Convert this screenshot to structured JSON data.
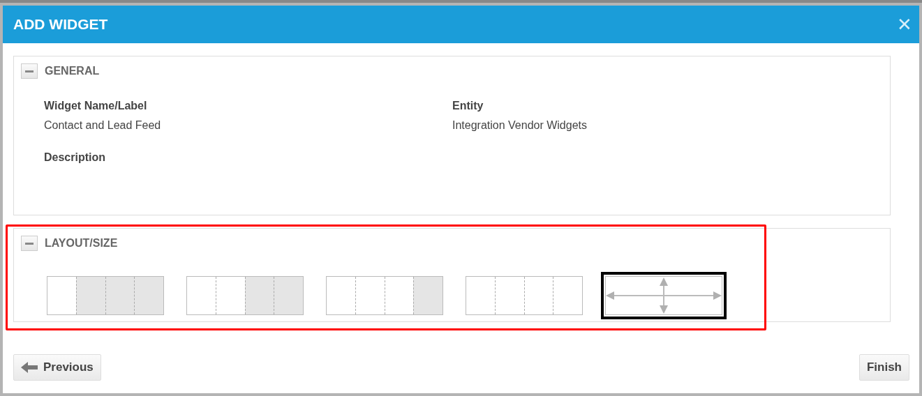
{
  "window": {
    "title": "ADD WIDGET",
    "close": "✕"
  },
  "general": {
    "title": "GENERAL",
    "expanded": true,
    "fields": [
      {
        "label": "Widget Name/Label",
        "value": "Contact and Lead Feed"
      },
      {
        "label": "Entity",
        "value": "Integration Vendor Widgets"
      },
      {
        "label": "Description"
      }
    ]
  },
  "layout": {
    "title": "LAYOUT/SIZE",
    "expanded": true,
    "highlighted": true,
    "options": [
      {
        "kind": "columns",
        "selected": false,
        "cells": [
          {
            "shaded": false
          },
          {
            "shaded": true
          },
          {
            "shaded": true
          },
          {
            "shaded": true
          }
        ]
      },
      {
        "kind": "columns",
        "selected": false,
        "cells": [
          {
            "shaded": false
          },
          {
            "shaded": false
          },
          {
            "shaded": true
          },
          {
            "shaded": true
          }
        ]
      },
      {
        "kind": "columns",
        "selected": false,
        "cells": [
          {
            "shaded": false
          },
          {
            "shaded": false
          },
          {
            "shaded": false
          },
          {
            "shaded": true
          }
        ]
      },
      {
        "kind": "columns",
        "selected": false,
        "cells": [
          {
            "shaded": false
          },
          {
            "shaded": false
          },
          {
            "shaded": false
          },
          {
            "shaded": false
          }
        ]
      },
      {
        "kind": "free",
        "selected": true
      }
    ]
  },
  "buttons": {
    "previous": "Previous",
    "finish": "Finish"
  }
}
